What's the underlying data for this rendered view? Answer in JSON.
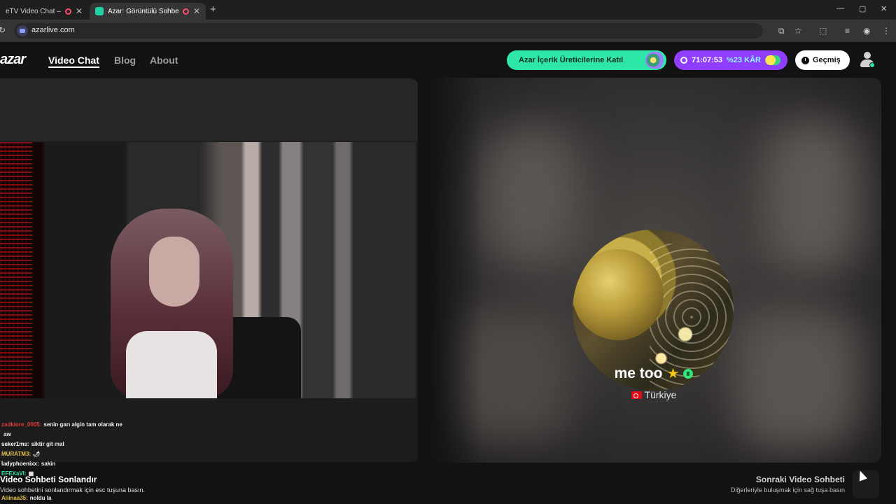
{
  "browser": {
    "tabs": [
      {
        "title": "eTV Video Chat — Ome"
      },
      {
        "title": "Azar: Görüntülü Sohbet & V"
      }
    ],
    "url": "azarlive.com"
  },
  "header": {
    "logo": "azar",
    "nav": [
      {
        "label": "Video Chat"
      },
      {
        "label": "Blog"
      },
      {
        "label": "About"
      }
    ],
    "join_label": "Azar İçerik Üreticilerine Katıl",
    "timer": "71:07:53",
    "profit": "%23 KÂR",
    "history_label": "Geçmiş"
  },
  "chat": [
    {
      "user": "zadkiore_0005:",
      "msg": "senin garı algin tam olarak ne",
      "color": "#e33b3b"
    },
    {
      "user": "",
      "msg": "aw",
      "color": "#ffffff"
    },
    {
      "user": "seker1ms:",
      "msg": "siktir git mal",
      "color": "#ffffff"
    },
    {
      "user": "MURATM3:",
      "msg": "🌶",
      "color": "#e8c34a"
    },
    {
      "user": "ladyphoenixx:",
      "msg": "sakin",
      "color": "#ffffff"
    },
    {
      "user": "EFEXaVI:",
      "msg": "▦",
      "color": "#2ee6a8"
    }
  ],
  "chat_last": {
    "user": "Aliinaa35:",
    "msg": "noldu la",
    "color": "#e8c34a"
  },
  "partner": {
    "name": "me too",
    "country": "Türkiye"
  },
  "footer": {
    "end_title": "Video Sohbeti Sonlandır",
    "end_hint": "Video sohbetini sonlandırmak için esc tuşuna basın.",
    "next_title": "Sonraki Video Sohbeti",
    "next_hint": "Diğerleriyle buluşmak için sağ tuşa basın"
  }
}
